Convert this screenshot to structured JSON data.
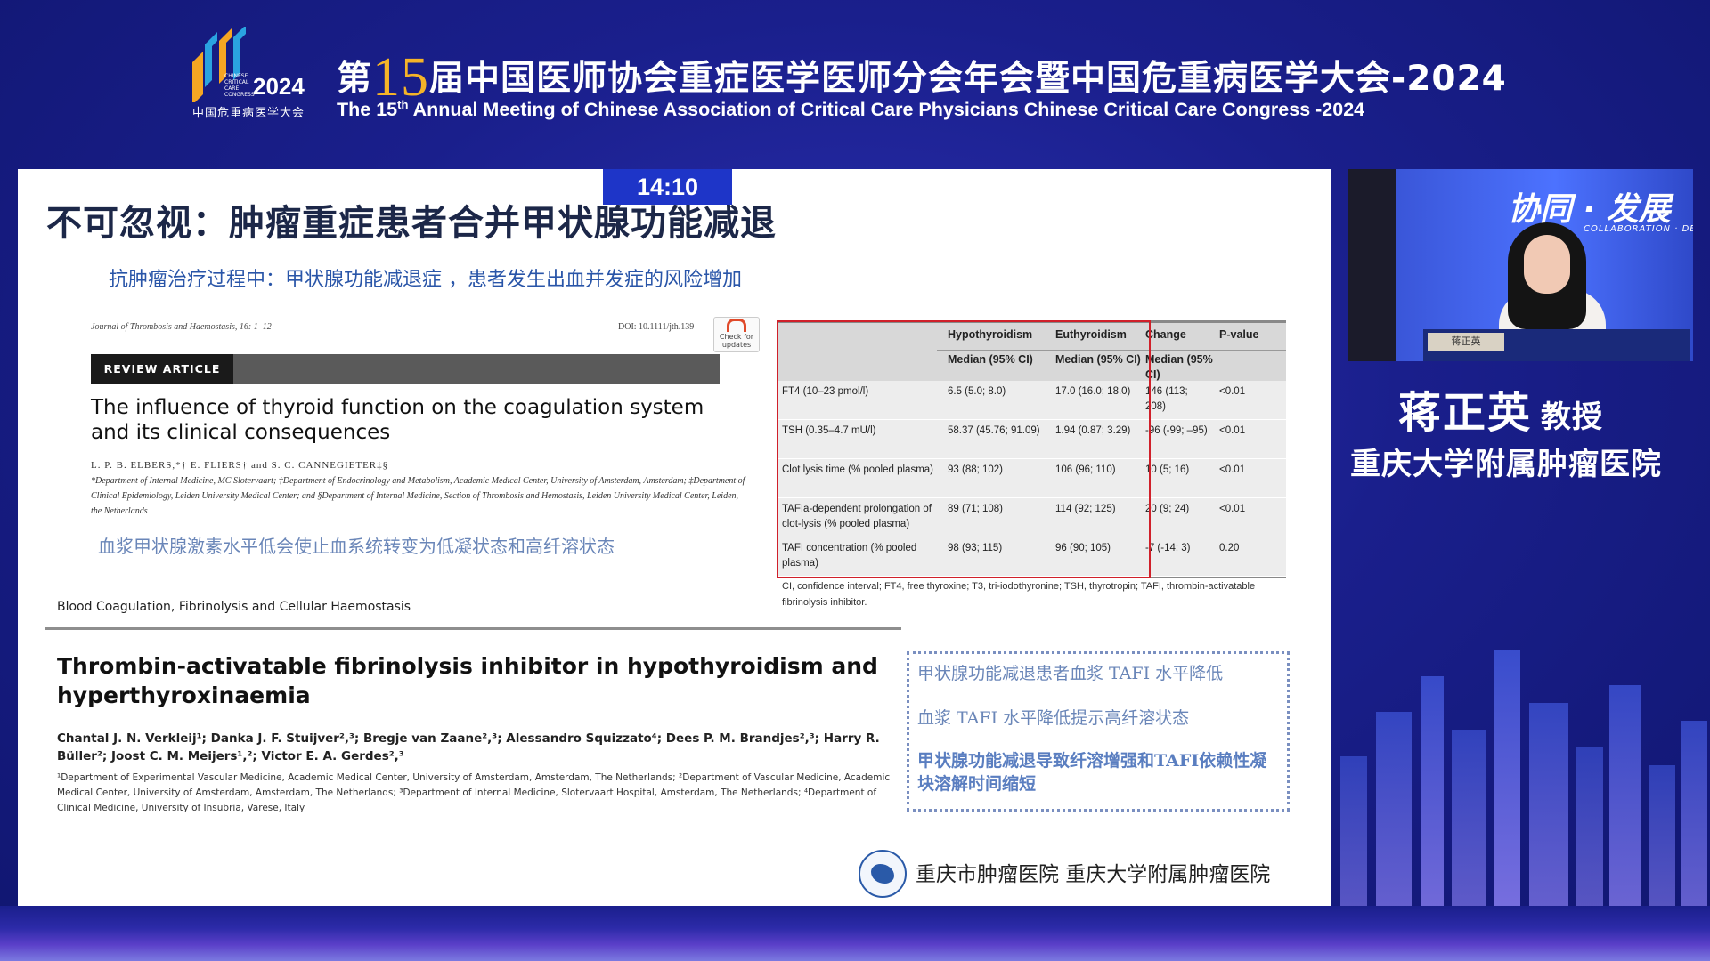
{
  "header": {
    "logo": {
      "org_cn": "中国危重病医学大会",
      "org_en_lines": [
        "CHINESE",
        "CRITICAL",
        "CARE",
        "CONGRESS"
      ],
      "year": "2024",
      "colors": [
        "#f5a623",
        "#2aa3e0",
        "#ffffff"
      ]
    },
    "title_cn_prefix": "第",
    "title_cn_number": "15",
    "title_cn_suffix": "届中国医师协会重症医学医师分会年会暨中国危重病医学大会-2024",
    "title_en_prefix": "The 15",
    "title_en_sup": "th",
    "title_en_suffix": " Annual Meeting of Chinese Association of Critical Care Physicians Chinese Critical Care Congress -2024"
  },
  "timer": "14:10",
  "slide": {
    "title": "不可忽视：肿瘤重症患者合并甲状腺功能减退",
    "subtitle": "抗肿瘤治疗过程中：甲状腺功能减退症 ，患者发生出血并发症的风险增加",
    "paper1": {
      "journal": "Journal of Thrombosis and Haemostasis, 16: 1–12",
      "doi": "DOI: 10.1111/jth.139",
      "check_updates": "Check for updates",
      "article_type": "REVIEW ARTICLE",
      "title": "The influence of thyroid function on the coagulation system and its clinical consequences",
      "authors": "L. P. B. ELBERS,*† E. FLIERS† and S. C. CANNEGIETER‡§",
      "affiliations": "*Department of Internal Medicine, MC Slotervaart; †Department of Endocrinology and Metabolism, Academic Medical Center, University of Amsterdam, Amsterdam; ‡Department of Clinical Epidemiology, Leiden University Medical Center; and §Department of Internal Medicine, Section of Thrombosis and Hemostasis, Leiden University Medical Center, Leiden, the Netherlands",
      "note_cn": "血浆甲状腺激素水平低会使止血系统转变为低凝状态和高纤溶状态",
      "footer": "Blood Coagulation, Fibrinolysis and Cellular Haemostasis"
    },
    "table": {
      "headers": [
        "",
        "Hypothyroidism",
        "Euthyroidism",
        "Change",
        "P-value"
      ],
      "subheaders": [
        "",
        "Median (95% CI)",
        "Median (95% CI)",
        "Median (95% CI)",
        ""
      ],
      "rows": [
        [
          "FT4 (10–23 pmol/l)",
          "6.5 (5.0; 8.0)",
          "17.0 (16.0; 18.0)",
          "146 (113; 208)",
          "<0.01"
        ],
        [
          "TSH (0.35–4.7 mU/l)",
          "58.37 (45.76; 91.09)",
          "1.94 (0.87; 3.29)",
          "-96 (-99; –95)",
          "<0.01"
        ],
        [
          "Clot lysis time (% pooled plasma)",
          "93 (88; 102)",
          "106 (96; 110)",
          "10 (5; 16)",
          "<0.01"
        ],
        [
          "TAFIa-dependent prolongation of clot-lysis (% pooled plasma)",
          "89 (71; 108)",
          "114 (92; 125)",
          "20 (9; 24)",
          "<0.01"
        ],
        [
          "TAFI concentration (% pooled plasma)",
          "98 (93; 115)",
          "96 (90; 105)",
          "-7 (-14; 3)",
          "0.20"
        ]
      ],
      "footnote": "CI, confidence interval; FT4, free thyroxine; T3, tri-iodothyronine; TSH, thyrotropin; TAFI, thrombin-activatable fibrinolysis inhibitor.",
      "highlight_color": "#d0202a"
    },
    "paper2": {
      "title": "Thrombin-activatable fibrinolysis inhibitor in hypothyroidism and hyperthyroxinaemia",
      "authors": "Chantal J. N. Verkleij¹; Danka J. F. Stuijver²,³; Bregje van Zaane²,³; Alessandro Squizzato⁴; Dees P. M. Brandjes²,³; Harry R. Büller²; Joost C. M. Meijers¹,²; Victor E. A. Gerdes²,³",
      "affiliations": "¹Department of Experimental Vascular Medicine, Academic Medical Center, University of Amsterdam, Amsterdam, The Netherlands; ²Department of Vascular Medicine, Academic Medical Center, University of Amsterdam, Amsterdam, The Netherlands; ³Department of Internal Medicine, Slotervaart Hospital, Amsterdam, The Netherlands; ⁴Department of Clinical Medicine, University of Insubria, Varese, Italy"
    },
    "notes": [
      "甲状腺功能减退患者血浆 TAFI 水平降低",
      "血浆 TAFI 水平降低提示高纤溶状态",
      "甲状腺功能减退导致纤溶增强和TAFI依赖性凝块溶解时间缩短"
    ],
    "hospital_names": "重庆市肿瘤医院  重庆大学附属肿瘤医院"
  },
  "speaker": {
    "video_banner": "协同 · 发展",
    "video_banner_en": "COLLABORATION · DE",
    "nameplate": "蒋正英",
    "name": "蒋正英",
    "title": "教授",
    "hospital": "重庆大学附属肿瘤医院"
  },
  "colors": {
    "background": "#1a1f8c",
    "accent_gold": "#f5b428",
    "timer_blue": "#1e35c8",
    "slide_title": "#1c2748",
    "note_blue": "#6a86b8"
  }
}
